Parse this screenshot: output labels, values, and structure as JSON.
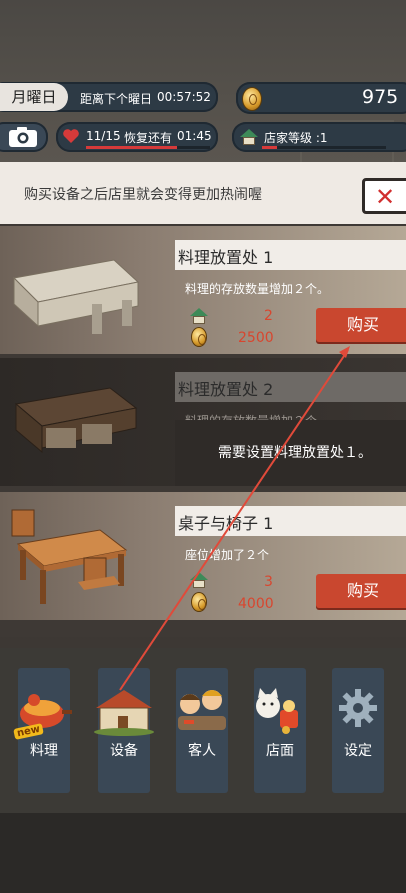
{
  "header": {
    "weekday": "月曜日",
    "countdown_label": "距离下个曜日",
    "countdown_time": "00:57:52",
    "coins": "975",
    "hearts": "11/15",
    "recover_label": "恢复还有",
    "recover_time": "01:45",
    "shop_level": "店家等级 :1"
  },
  "banner": {
    "text": "购买设备之后店里就会变得更加热闹喔"
  },
  "items": [
    {
      "name": "料理放置处 1",
      "desc": "料理的存放数量增加２个。",
      "level_req": "2",
      "price": "2500",
      "buy_label": "购买"
    },
    {
      "name": "料理放置处 2",
      "desc": "料理的存放数量增加２个。",
      "locked_message": "需要设置料理放置处１。"
    },
    {
      "name": "桌子与椅子 1",
      "desc": "座位增加了２个",
      "level_req": "3",
      "price": "4000",
      "buy_label": "购买"
    }
  ],
  "tabs": [
    {
      "label": "料理",
      "icon": "cooking-pot-icon",
      "badge": "new"
    },
    {
      "label": "设备",
      "icon": "equipment-icon"
    },
    {
      "label": "客人",
      "icon": "customers-icon"
    },
    {
      "label": "店面",
      "icon": "storefront-icon"
    },
    {
      "label": "设定",
      "icon": "gear-icon"
    }
  ],
  "colors": {
    "accent_red": "#c9472f",
    "pill_bg": "#2d3a45",
    "tab_bg": "#3a4856"
  }
}
